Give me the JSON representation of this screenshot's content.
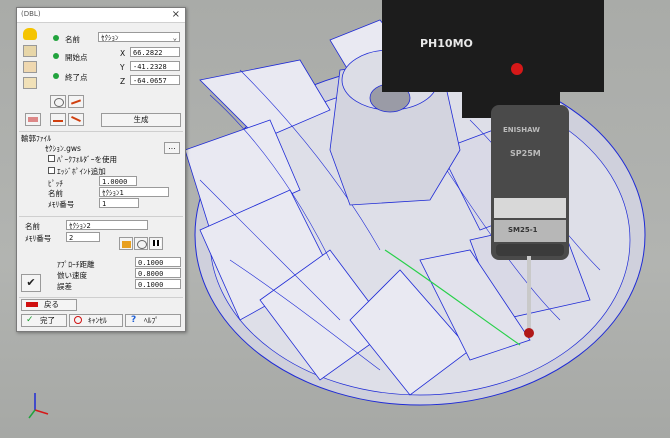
{
  "dialog": {
    "title": "(DBL)",
    "close_glyph": "×",
    "name_label": "名前",
    "name_value": "ｾｸｼｮﾝ",
    "start_label": "開始点",
    "end_label": "終了点",
    "coords": {
      "x_label": "X",
      "y_label": "Y",
      "z_label": "Z",
      "x": "66.2822",
      "y": "-41.2328",
      "z": "-64.0657"
    },
    "generate_label": "生成",
    "output_file_label": "輸郭ﾌｧｲﾙ",
    "file_value": "ｾｸｼｮﾝ.gws",
    "browse_label": "...",
    "use_pathfolder_label": "ﾊﾟｰｸﾌｫﾙﾀﾞｰを使用",
    "add_edge_points_label": "ｴｯｼﾞﾎﾟｲﾝﾄ追加",
    "pitch_label": "ﾋﾟｯﾁ",
    "pitch_value": "1.0000",
    "section_name_label": "名前",
    "section_name_value": "ｾｸｼｮﾝ1",
    "memory_label": "ﾒﾓﾘ番号",
    "memory_value": "1",
    "name2_label": "名前",
    "name2_value": "ｾｸｼｮﾝ2",
    "memory2_label": "ﾒﾓﾘ番号",
    "memory2_value": "2",
    "approach_label": "ｱﾌﾟﾛｰﾁ距離",
    "approach_value": "0.1000",
    "speed_label": "倣い速度",
    "speed_value": "0.8000",
    "tolerance_label": "誤差",
    "tolerance_value": "0.1000",
    "back_label": "戻る",
    "done_label": "完了",
    "cancel_label": "ｷｬﾝｾﾙ",
    "help_label": "ﾍﾙﾌﾟ"
  },
  "scene": {
    "probe_head_text": "PH10MO",
    "probe_brand_text": "ENISHAW",
    "probe_model_text": "SP25M",
    "stylus_module_text": "SM25-1"
  },
  "colors": {
    "background": "#a9aba8",
    "impeller_outline": "#1f2bd6",
    "probe_body": "#1c1c1c",
    "indicator_red": "#d61818",
    "status_green": "#21a33d"
  }
}
